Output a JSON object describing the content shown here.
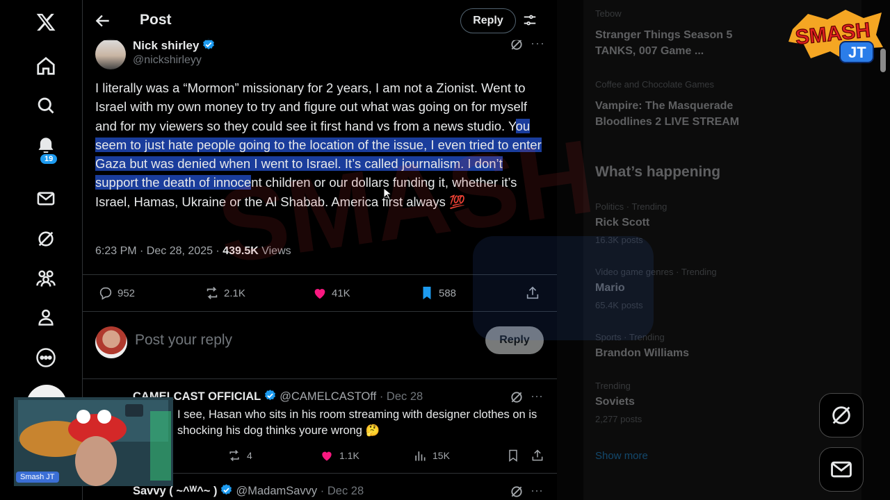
{
  "nav": {
    "notif_count": "19"
  },
  "header": {
    "title": "Post",
    "reply_label": "Reply"
  },
  "post": {
    "author_name": "Nick shirley",
    "author_handle": "@nickshirleyy",
    "text_before": "I literally was a “Mormon” missionary for 2 years, I am not a Zionist. Went to Israel with my own money to try and figure out what was going on for myself and for my viewers so they could see it first hand vs from a news studio. Y",
    "text_highlight": "ou seem to just hate people going to the location of the issue, I even tried to enter Gaza but was denied when I went to Israel. It’s called journalism. I don’t support the death of innoce",
    "text_after": "nt children or our dollars funding it, whether it’s Israel, Hamas, Ukraine or the Al Shabab.  America first always 💯",
    "time": "6:23 PM · Dec 28, 2025 · ",
    "views_count": "439.5K",
    "views_label": " Views",
    "replies": "952",
    "reposts": "2.1K",
    "likes": "41K",
    "bookmarks": "588"
  },
  "compose": {
    "placeholder": "Post your reply",
    "button": "Reply"
  },
  "replies": [
    {
      "name": "CAMELCAST OFFICIAL",
      "handle": "@CAMELCASTOff",
      "date": " · Dec 28",
      "text": "I see, Hasan who sits in his room streaming with designer clothes on is shocking his dog thinks youre wrong 🤔",
      "reposts": "4",
      "likes": "1.1K",
      "views": "15K"
    },
    {
      "name": "Savvy ( ~^ᵂ^~ )",
      "handle": "@MadamSavvy",
      "date": " · Dec 28"
    }
  ],
  "sidebar": {
    "trend_top_source": "Tebow",
    "trend_top_title_1": "Stranger Things Season 5",
    "trend_top_title_2": "TANKS, 007 Game ...",
    "trend_2_source": "Coffee and Chocolate Games",
    "trend_2_title_1": "Vampire: The Masquerade",
    "trend_2_title_2": "Bloodlines 2 LIVE STREAM",
    "whats_happening": "What’s happening",
    "trends": [
      {
        "category": "Politics · Trending",
        "name": "Rick Scott",
        "count": "16.3K posts"
      },
      {
        "category": "Video game genres · Trending",
        "name": "Mario",
        "count": "65.4K posts"
      },
      {
        "category": "Sports · Trending",
        "name": "Brandon Williams",
        "count": ""
      },
      {
        "category": "Trending",
        "name": "Soviets",
        "count": "2,277 posts"
      }
    ],
    "show_more": "Show more"
  },
  "overlay": {
    "logo_top": "SMASH",
    "logo_bottom": "JT",
    "webcam_tag": "Smash JT"
  },
  "colors": {
    "accent": "#1d9bf0",
    "like": "#f91880",
    "highlight": "#1a3d9c",
    "bookmark": "#1d9bf0"
  }
}
